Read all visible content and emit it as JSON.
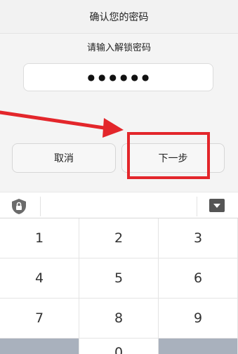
{
  "dialog": {
    "title": "确认您的密码",
    "prompt": "请输入解锁密码",
    "password_mask": "●●●●●●",
    "cancel_label": "取消",
    "next_label": "下一步"
  },
  "annotation": {
    "color": "#e3262b"
  },
  "keyboard": {
    "keys": [
      {
        "label": "1"
      },
      {
        "label": "2"
      },
      {
        "label": "3"
      },
      {
        "label": "4"
      },
      {
        "label": "5"
      },
      {
        "label": "6"
      },
      {
        "label": "7"
      },
      {
        "label": "8"
      },
      {
        "label": "9"
      },
      {
        "label": ""
      },
      {
        "label": "0"
      },
      {
        "label": ""
      }
    ]
  }
}
